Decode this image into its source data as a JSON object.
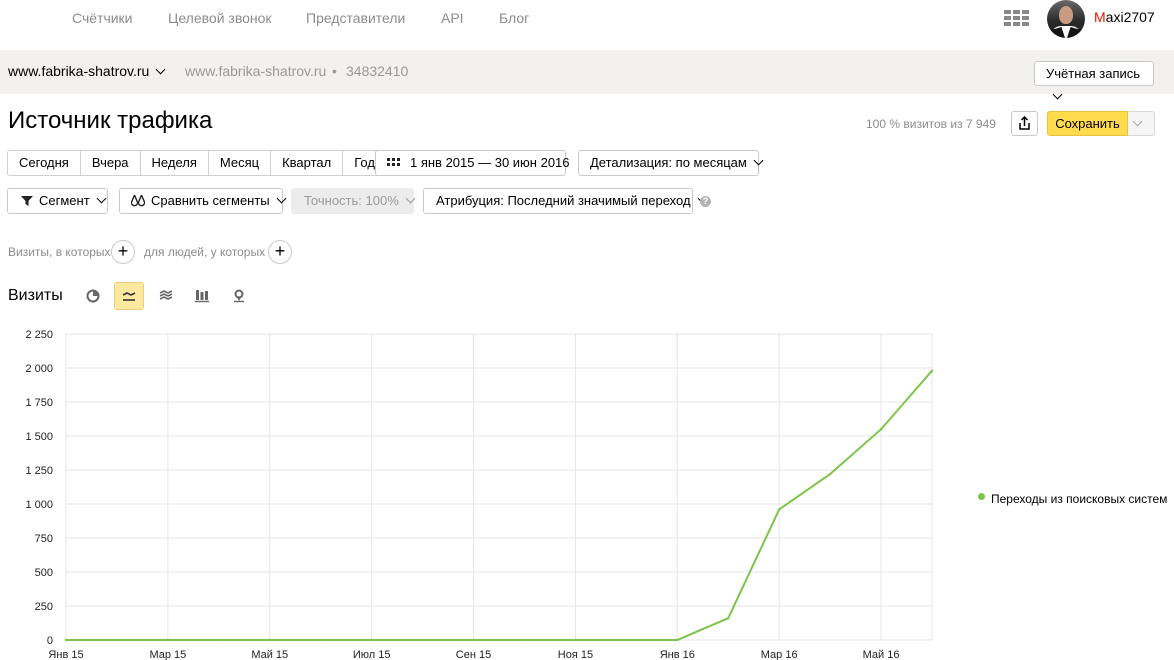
{
  "nav": {
    "items": [
      "Счётчики",
      "Целевой звонок",
      "Представители",
      "API",
      "Блог"
    ],
    "username_first": "M",
    "username_rest": "axi2707"
  },
  "sitebar": {
    "site_name": "www.fabrika-shatrov.ru",
    "site_url": "www.fabrika-shatrov.ru",
    "separator": "•",
    "counter_id": "34832410",
    "account_label": "Учётная запись"
  },
  "header": {
    "title": "Источник трафика",
    "visits_share": "100 % визитов из 7 949",
    "save_label": "Сохранить"
  },
  "period": {
    "options": [
      "Сегодня",
      "Вчера",
      "Неделя",
      "Месяц",
      "Квартал",
      "Год"
    ],
    "date_range": "1 янв 2015 — 30 июн 2016",
    "detail": "Детализация: по месяцам"
  },
  "filters": {
    "segment": "Сегмент",
    "compare": "Сравнить сегменты",
    "accuracy": "Точность: 100%",
    "attribution": "Атрибуция: Последний значимый переход",
    "help": "?",
    "visits_where": "Визиты, в которых",
    "people_where": "для людей, у которых",
    "plus": "+"
  },
  "report": {
    "metric_label": "Визиты",
    "chart_types": [
      "pie-chart-icon",
      "line-chart-icon",
      "area-chart-icon",
      "bar-chart-icon",
      "map-icon"
    ],
    "active_chart_type": "line-chart-icon"
  },
  "chart_data": {
    "type": "line",
    "title": "",
    "xlabel": "",
    "ylabel": "",
    "x": [
      "2015-01",
      "2015-02",
      "2015-03",
      "2015-04",
      "2015-05",
      "2015-06",
      "2015-07",
      "2015-08",
      "2015-09",
      "2015-10",
      "2015-11",
      "2015-12",
      "2016-01",
      "2016-02",
      "2016-03",
      "2016-04",
      "2016-05",
      "2016-06"
    ],
    "x_tick_labels": [
      "Янв 15",
      "Мар 15",
      "Май 15",
      "Июл 15",
      "Сен 15",
      "Ноя 15",
      "Янв 16",
      "Мар 16",
      "Май 16"
    ],
    "y_tick_labels": [
      "2 250",
      "2 000",
      "1 750",
      "1 500",
      "1 250",
      "1 000",
      "750",
      "500",
      "250",
      "0"
    ],
    "ylim": [
      0,
      2250
    ],
    "grid": true,
    "legend_position": "right",
    "series": [
      {
        "name": "Переходы из поисковых систем",
        "color": "#7ec44a",
        "values": [
          0,
          0,
          0,
          0,
          0,
          0,
          0,
          0,
          0,
          0,
          0,
          0,
          0,
          160,
          960,
          1220,
          1550,
          1980
        ]
      }
    ]
  }
}
